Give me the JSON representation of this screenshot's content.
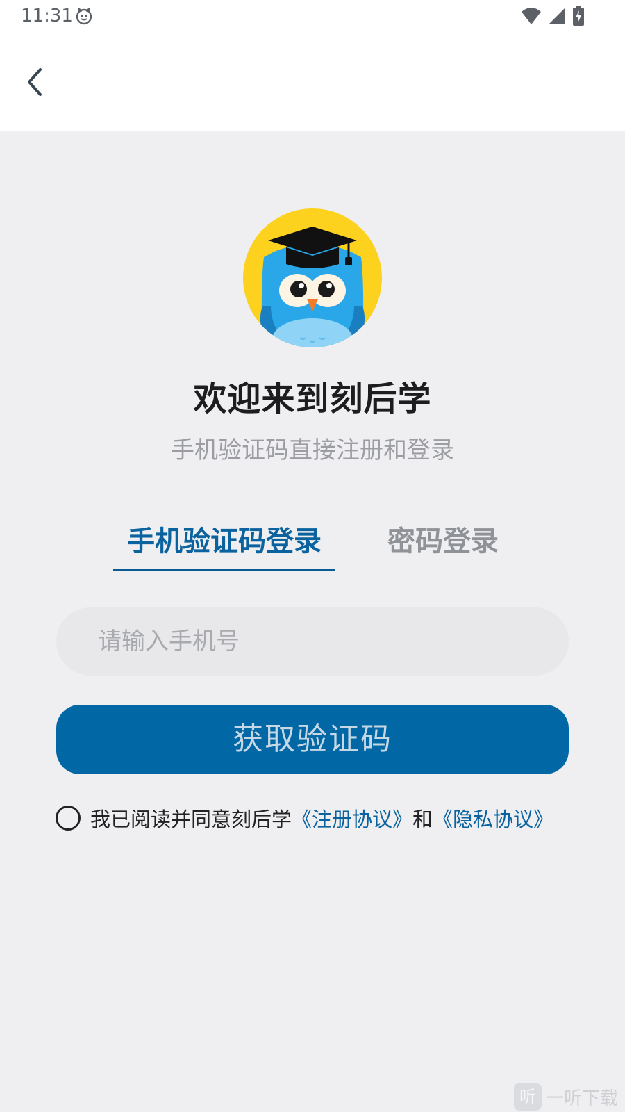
{
  "status_bar": {
    "time": "11:31"
  },
  "header": {
    "back_icon": "chevron-left-icon"
  },
  "welcome": {
    "title": "欢迎来到刻后学",
    "subtitle": "手机验证码直接注册和登录"
  },
  "tabs": [
    {
      "label": "手机验证码登录",
      "active": true
    },
    {
      "label": "密码登录",
      "active": false
    }
  ],
  "phone_input": {
    "placeholder": "请输入手机号",
    "value": ""
  },
  "get_code_button": {
    "label": "获取验证码"
  },
  "agreement": {
    "prefix": "我已阅读并同意刻后学",
    "register_link": "《注册协议》",
    "and_text": "和",
    "privacy_link": "《隐私协议》",
    "checked": false
  },
  "watermark": {
    "logo_char": "听",
    "text": "一听下载"
  },
  "colors": {
    "accent": "#0267a5",
    "tab_active": "#0a639e",
    "background": "#efeff2",
    "logo_yellow": "#fdd21f",
    "owl_blue": "#29a7e8"
  }
}
